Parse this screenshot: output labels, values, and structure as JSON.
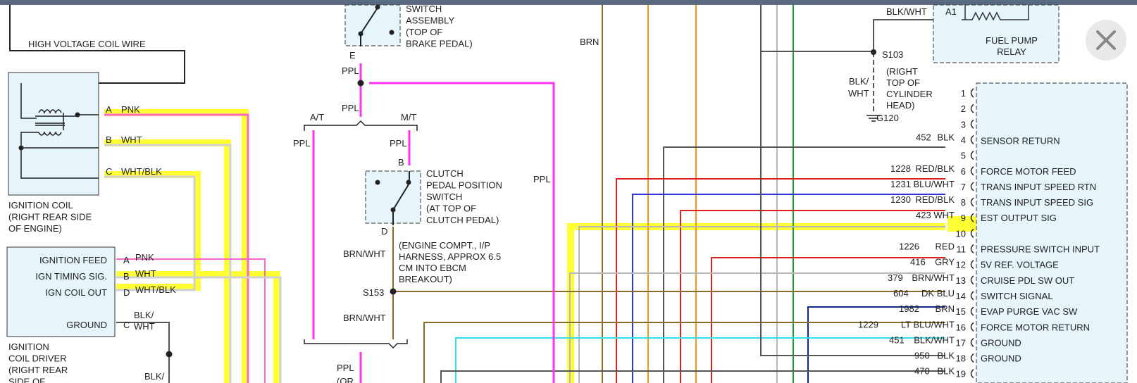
{
  "close_label": "close",
  "labels": {
    "switch_assembly": [
      "SWITCH",
      "ASSEMBLY",
      "(TOP OF",
      "BRAKE PEDAL)"
    ],
    "high_voltage": "HIGH VOLTAGE COIL WIRE",
    "brn": "BRN",
    "blk_wht": "BLK/WHT",
    "a1": "A1",
    "fuel_pump_relay": [
      "FUEL PUMP",
      "RELAY"
    ],
    "s103": "S103",
    "s103_note": [
      "(RIGHT",
      "TOP OF",
      "CYLINDER",
      "HEAD)"
    ],
    "blk_slash": "BLK/",
    "wht": "WHT",
    "g120": "G120",
    "e": "E",
    "ppl": "PPL",
    "at": "A/T",
    "mt": "M/T",
    "b": "B",
    "d": "D",
    "clutch": [
      "CLUTCH",
      "PEDAL POSITION",
      "SWITCH",
      "(AT TOP OF",
      "CLUTCH PEDAL)"
    ],
    "ign_coil": [
      "IGNITION COIL",
      "(RIGHT REAR SIDE",
      "OF ENGINE)"
    ],
    "coil_pins": [
      {
        "pin": "A",
        "color": "PNK"
      },
      {
        "pin": "B",
        "color": "WHT"
      },
      {
        "pin": "C",
        "color": "WHT/BLK"
      }
    ],
    "driver_pins": [
      {
        "name": "IGNITION FEED",
        "pin": "A",
        "color": "PNK"
      },
      {
        "name": "IGN TIMING SIG.",
        "pin": "B",
        "color": "WHT"
      },
      {
        "name": "IGN COIL OUT",
        "pin": "D",
        "color": "WHT/BLK"
      },
      {
        "name": "GROUND",
        "pin": "C",
        "color": "WHT"
      }
    ],
    "blk": "BLK/",
    "ign_driver": [
      "IGNITION",
      "COIL DRIVER",
      "(RIGHT REAR",
      "SIDE OF"
    ],
    "brn_wht": "BRN/WHT",
    "harness": [
      "(ENGINE COMPT., I/P",
      "HARNESS, APPROX 6.5",
      "CM INTO EBCM",
      "BREAKOUT)"
    ],
    "s153": "S153",
    "or_partial": "(OR"
  },
  "pins": [
    {
      "num": "1",
      "wire": "",
      "color": "",
      "name": ""
    },
    {
      "num": "2",
      "wire": "",
      "color": "",
      "name": ""
    },
    {
      "num": "3",
      "wire": "",
      "color": "",
      "name": ""
    },
    {
      "num": "4",
      "wire": "452",
      "color": "BLK",
      "name": ""
    },
    {
      "num": "5",
      "wire": "",
      "color": "",
      "name": "SENSOR RETURN"
    },
    {
      "num": "6",
      "wire": "1228",
      "color": "RED/BLK",
      "name": "FORCE MOTOR FEED"
    },
    {
      "num": "7",
      "wire": "1231",
      "color": "BLU/WHT",
      "name": "TRANS INPUT SPEED RTN"
    },
    {
      "num": "8",
      "wire": "1230",
      "color": "RED/BLK",
      "name": "TRANS INPUT SPEED SIG"
    },
    {
      "num": "9",
      "wire": "423",
      "color": "WHT",
      "name": "EST OUTPUT SIG"
    },
    {
      "num": "10",
      "wire": "",
      "color": "",
      "name": ""
    },
    {
      "num": "11",
      "wire": "1226",
      "color": "RED",
      "name": "PRESSURE SWITCH INPUT"
    },
    {
      "num": "12",
      "wire": "416",
      "color": "GRY",
      "name": "5V REF. VOLTAGE"
    },
    {
      "num": "13",
      "wire": "379",
      "color": "BRN/WHT",
      "name": "CRUISE PDL SW OUT"
    },
    {
      "num": "14",
      "wire": "604",
      "color": "DK BLU",
      "name": "SWITCH SIGNAL"
    },
    {
      "num": "15",
      "wire": "1982",
      "color": "BRN",
      "name": "EVAP PURGE VAC SW"
    },
    {
      "num": "16",
      "wire": "1229",
      "color": "LT BLU/WHT",
      "name": "FORCE MOTOR RETURN"
    },
    {
      "num": "17",
      "wire": "451",
      "color": "BLK/WHT",
      "name": "GROUND"
    },
    {
      "num": "18",
      "wire": "950",
      "color": "BLK",
      "name": "GROUND"
    },
    {
      "num": "19",
      "wire": "470",
      "color": "BLK",
      "name": ""
    }
  ],
  "colors": {
    "highlight": "#ffff33",
    "pink": "#ff66cc",
    "ppl": "#ff33ee",
    "brown": "#8a6d2b",
    "orange": "#f7931e",
    "gray": "#b8b8b8",
    "green": "#1a9b3a",
    "red": "#e02020",
    "blue": "#3333dd",
    "dkblue": "#102a8a",
    "ltblue": "#33ddee",
    "black": "#333333",
    "boxfill": "#e6f4fb"
  }
}
